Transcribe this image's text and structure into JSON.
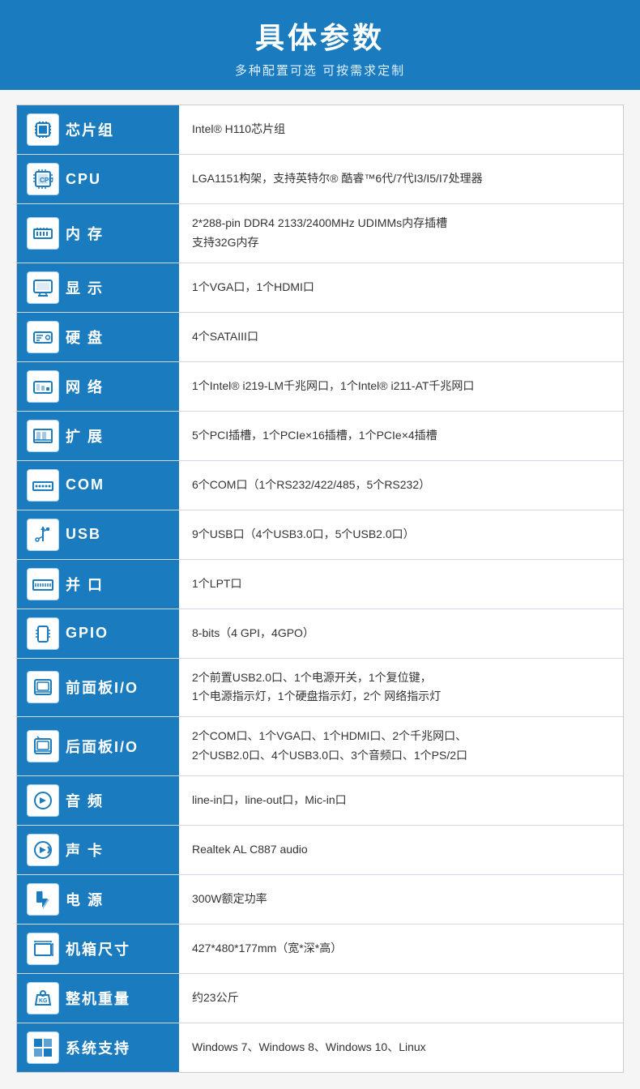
{
  "header": {
    "title": "具体参数",
    "subtitle": "多种配置可选 可按需求定制"
  },
  "rows": [
    {
      "id": "chipset",
      "label": "芯片组",
      "icon": "chipset",
      "value": "Intel® H110芯片组"
    },
    {
      "id": "cpu",
      "label": "CPU",
      "icon": "cpu",
      "value": "LGA1151构架，支持英特尔® 酷睿™6代/7代I3/I5/I7处理器"
    },
    {
      "id": "memory",
      "label": "内 存",
      "icon": "memory",
      "value": "2*288-pin DDR4 2133/2400MHz UDIMMs内存插槽\n支持32G内存"
    },
    {
      "id": "display",
      "label": "显 示",
      "icon": "display",
      "value": "1个VGA口，1个HDMI口"
    },
    {
      "id": "hdd",
      "label": "硬 盘",
      "icon": "hdd",
      "value": "4个SATAIII口"
    },
    {
      "id": "network",
      "label": "网 络",
      "icon": "network",
      "value": "1个Intel® i219-LM千兆网口，1个Intel® i211-AT千兆网口"
    },
    {
      "id": "expansion",
      "label": "扩 展",
      "icon": "expansion",
      "value": "5个PCI插槽，1个PCIe×16插槽，1个PCIe×4插槽"
    },
    {
      "id": "com",
      "label": "COM",
      "icon": "com",
      "value": "6个COM口（1个RS232/422/485，5个RS232）"
    },
    {
      "id": "usb",
      "label": "USB",
      "icon": "usb",
      "value": "9个USB口（4个USB3.0口，5个USB2.0口）"
    },
    {
      "id": "parallel",
      "label": "并 口",
      "icon": "parallel",
      "value": "1个LPT口"
    },
    {
      "id": "gpio",
      "label": "GPIO",
      "icon": "gpio",
      "value": "8-bits（4 GPI，4GPO）"
    },
    {
      "id": "front-panel",
      "label": "前面板I/O",
      "icon": "frontpanel",
      "value": "2个前置USB2.0口、1个电源开关，1个复位键，\n1个电源指示灯，1个硬盘指示灯，2个 网络指示灯"
    },
    {
      "id": "rear-panel",
      "label": "后面板I/O",
      "icon": "rearpanel",
      "value": "2个COM口、1个VGA口、1个HDMI口、2个千兆网口、\n2个USB2.0口、4个USB3.0口、3个音频口、1个PS/2口"
    },
    {
      "id": "audio",
      "label": "音 频",
      "icon": "audio",
      "value": "line-in口，line-out口，Mic-in口"
    },
    {
      "id": "soundcard",
      "label": "声 卡",
      "icon": "soundcard",
      "value": "Realtek AL C887 audio"
    },
    {
      "id": "power",
      "label": "电 源",
      "icon": "power",
      "value": "300W额定功率"
    },
    {
      "id": "dimensions",
      "label": "机箱尺寸",
      "icon": "dimensions",
      "value": "427*480*177mm（宽*深*高）"
    },
    {
      "id": "weight",
      "label": "整机重量",
      "icon": "weight",
      "value": "约23公斤"
    },
    {
      "id": "os",
      "label": "系统支持",
      "icon": "os",
      "value": "Windows 7、Windows 8、Windows 10、Linux"
    }
  ]
}
